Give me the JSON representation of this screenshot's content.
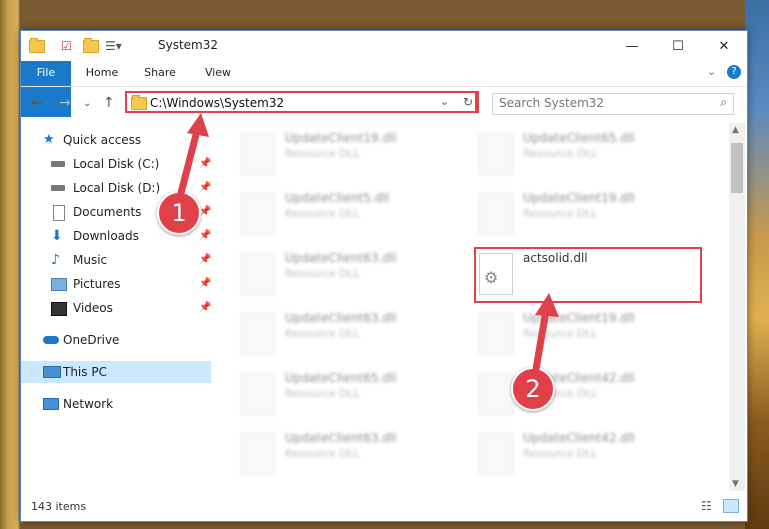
{
  "window": {
    "title": "System32"
  },
  "ribbon": {
    "tabs": [
      "File",
      "Home",
      "Share",
      "View"
    ]
  },
  "address": {
    "path": "C:\\Windows\\System32",
    "search_placeholder": "Search System32"
  },
  "sidebar": {
    "items": [
      {
        "label": "Quick access",
        "icon": "star-icon"
      },
      {
        "label": "Local Disk (C:)",
        "icon": "drive-icon",
        "pinned": true
      },
      {
        "label": "Local Disk (D:)",
        "icon": "drive-icon",
        "pinned": true
      },
      {
        "label": "Documents",
        "icon": "documents-icon",
        "pinned": true
      },
      {
        "label": "Downloads",
        "icon": "downloads-icon",
        "pinned": true
      },
      {
        "label": "Music",
        "icon": "music-icon",
        "pinned": true
      },
      {
        "label": "Pictures",
        "icon": "pictures-icon",
        "pinned": true
      },
      {
        "label": "Videos",
        "icon": "videos-icon",
        "pinned": true
      },
      {
        "label": "OneDrive",
        "icon": "cloud-icon"
      },
      {
        "label": "This PC",
        "icon": "pc-icon",
        "selected": true
      },
      {
        "label": "Network",
        "icon": "network-icon"
      }
    ]
  },
  "files": {
    "left": [
      {
        "name": "UpdateClient19.dll",
        "type": "Resource DLL"
      },
      {
        "name": "UpdateClient5.dll",
        "type": "Resource DLL"
      },
      {
        "name": "UpdateClient63.dll",
        "type": "Resource DLL"
      },
      {
        "name": "UpdateClient63.dll",
        "type": "Resource DLL"
      },
      {
        "name": "UpdateClient65.dll",
        "type": "Resource DLL"
      },
      {
        "name": "UpdateClient63.dll",
        "type": "Resource DLL"
      }
    ],
    "right": [
      {
        "name": "UpdateClient65.dll",
        "type": "Resource DLL"
      },
      {
        "name": "UpdateClient19.dll",
        "type": "Resource DLL"
      },
      {
        "name": "actsolid.dll",
        "type": ""
      },
      {
        "name": "UpdateClient19.dll",
        "type": "Resource DLL"
      },
      {
        "name": "UpdateClient42.dll",
        "type": "Resource DLL"
      },
      {
        "name": "UpdateClient42.dll",
        "type": "Resource DLL"
      }
    ]
  },
  "status": {
    "count": "143 items"
  },
  "annotations": {
    "badge1": "1",
    "badge2": "2"
  },
  "colors": {
    "accent": "#1979ca",
    "highlight": "#e0404a",
    "selected": "#cce8ff"
  }
}
